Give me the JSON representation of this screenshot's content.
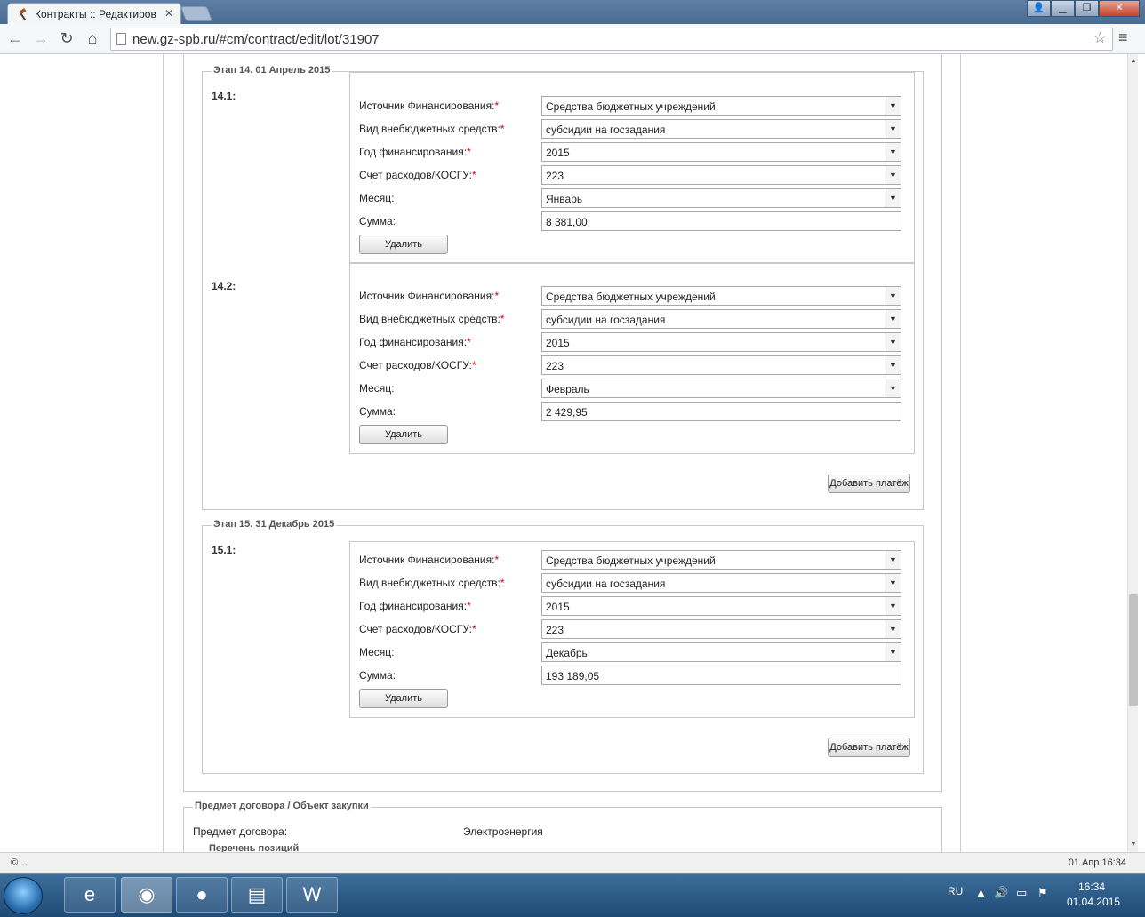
{
  "browser": {
    "tab_title": "Контракты :: Редактиров",
    "url": "new.gz-spb.ru/#cm/contract/edit/lot/31907"
  },
  "labels": {
    "source": "Источник Финансирования:",
    "type": "Вид внебюджетных средств:",
    "year": "Год финансирования:",
    "account": "Счет расходов/КОСГУ:",
    "month": "Месяц:",
    "sum": "Сумма:",
    "required_mark": "*",
    "delete": "Удалить",
    "add_payment": "Добавить платёж"
  },
  "stages": [
    {
      "legend": "Этап 14. 01 Апрель 2015",
      "payments": [
        {
          "num": "14.1:",
          "source": "Средства бюджетных учреждений",
          "type": "субсидии на госзадания",
          "year": "2015",
          "account": "223",
          "month": "Январь",
          "sum": "8 381,00"
        },
        {
          "num": "14.2:",
          "source": "Средства бюджетных учреждений",
          "type": "субсидии на госзадания",
          "year": "2015",
          "account": "223",
          "month": "Февраль",
          "sum": "2 429,95"
        }
      ]
    },
    {
      "legend": "Этап 15. 31 Декабрь 2015",
      "payments": [
        {
          "num": "15.1:",
          "source": "Средства бюджетных учреждений",
          "type": "субсидии на госзадания",
          "year": "2015",
          "account": "223",
          "month": "Декабрь",
          "sum": "193 189,05"
        }
      ]
    }
  ],
  "subject": {
    "legend": "Предмет договора / Объект закупки",
    "label": "Предмет договора:",
    "value": "Электроэнергия",
    "positions_legend": "Перечень позиций"
  },
  "status": {
    "left": "© ...",
    "right": "01 Апр 16:34"
  },
  "taskbar": {
    "lang": "RU",
    "time": "16:34",
    "date": "01.04.2015"
  }
}
